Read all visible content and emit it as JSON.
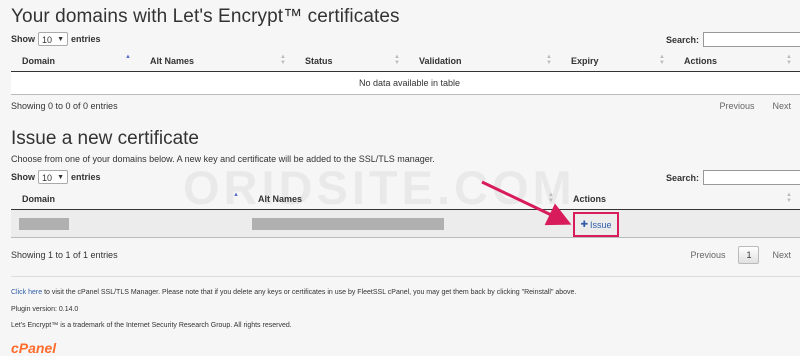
{
  "section1": {
    "title": "Your domains with Let's Encrypt™ certificates",
    "show_label": "Show",
    "entries_value": "10",
    "entries_label": "entries",
    "search_label": "Search:",
    "columns": [
      "Domain",
      "Alt Names",
      "Status",
      "Validation",
      "Expiry",
      "Actions"
    ],
    "empty_message": "No data available in table",
    "info": "Showing 0 to 0 of 0 entries",
    "prev": "Previous",
    "next": "Next"
  },
  "section2": {
    "title": "Issue a new certificate",
    "description": "Choose from one of your domains below. A new key and certificate will be added to the SSL/TLS manager.",
    "show_label": "Show",
    "entries_value": "10",
    "entries_label": "entries",
    "search_label": "Search:",
    "columns": [
      "Domain",
      "Alt Names",
      "Actions"
    ],
    "row_action": "Issue",
    "info": "Showing 1 to 1 of 1 entries",
    "prev": "Previous",
    "page": "1",
    "next": "Next"
  },
  "watermark": "ORIDSITE.COM",
  "footer": {
    "link_text": "Click here",
    "line1_rest": " to visit the cPanel SSL/TLS Manager. Please note that if you delete any keys or certificates in use by FleetSSL cPanel, you may get them back by clicking \"Reinstall\" above.",
    "version": "Plugin version: 0.14.0",
    "trademark": "Let's Encrypt™ is a trademark of the Internet Security Research Group. All rights reserved.",
    "logo": "cPanel"
  },
  "colors": {
    "highlight": "#d81b5a",
    "link": "#2f5da8",
    "cpanel": "#ff6c2c"
  }
}
